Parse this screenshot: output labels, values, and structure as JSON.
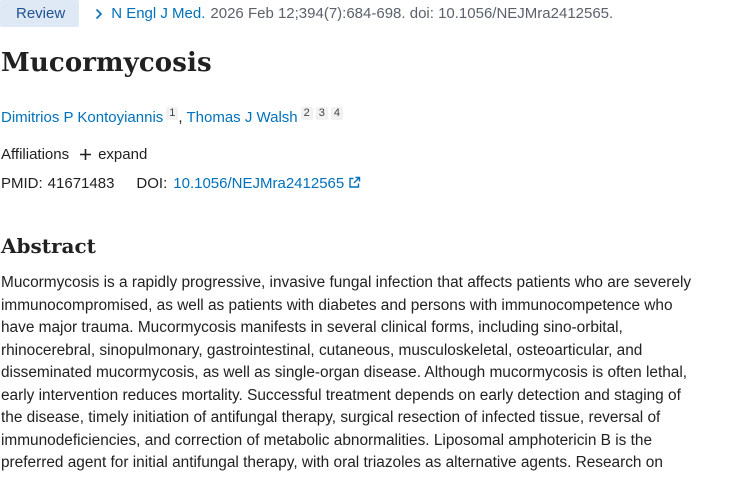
{
  "citation": {
    "type_badge": "Review",
    "journal": "N Engl J Med.",
    "details": "2026 Feb 12;394(7):684-698. doi: 10.1056/NEJMra2412565."
  },
  "article": {
    "title": "Mucormycosis",
    "authors": [
      {
        "name": "Dimitrios P Kontoyiannis",
        "affiliation_refs": [
          "1"
        ]
      },
      {
        "name": "Thomas J Walsh",
        "affiliation_refs": [
          "2",
          "3",
          "4"
        ]
      }
    ],
    "author_separator": ",",
    "affiliations_label": "Affiliations",
    "expand_label": "expand",
    "pmid_label": "PMID:",
    "pmid": "41671483",
    "doi_label": "DOI:",
    "doi": "10.1056/NEJMra2412565"
  },
  "abstract": {
    "heading": "Abstract",
    "lines": [
      "Mucormycosis is a rapidly progressive, invasive fungal infection that affects patients who are severely",
      "immunocompromised, as well as patients with diabetes and persons with immunocompetence who",
      "have major trauma. Mucormycosis manifests in several clinical forms, including sino-orbital,",
      "rhinocerebral, sinopulmonary, gastrointestinal, cutaneous, musculoskeletal, osteoarticular, and",
      "disseminated mucormycosis, as well as single-organ disease. Although mucormycosis is often lethal,",
      "early intervention reduces mortality. Successful treatment depends on early detection and staging of",
      "the disease, timely initiation of antifungal therapy, surgical resection of infected tissue, reversal of",
      "immunodeficiencies, and correction of metabolic abnormalities. Liposomal amphotericin B is the",
      "preferred agent for initial antifungal therapy, with oral triazoles as alternative agents. Research on"
    ]
  },
  "icons": {
    "journal_chevron": "chevron-right-icon",
    "expand": "plus-icon",
    "external_link": "external-link-icon"
  },
  "colors": {
    "link": "#0071bc",
    "badge_bg": "#dfe9f6",
    "badge_text": "#205493",
    "text": "#212121",
    "muted": "#5b616b"
  }
}
